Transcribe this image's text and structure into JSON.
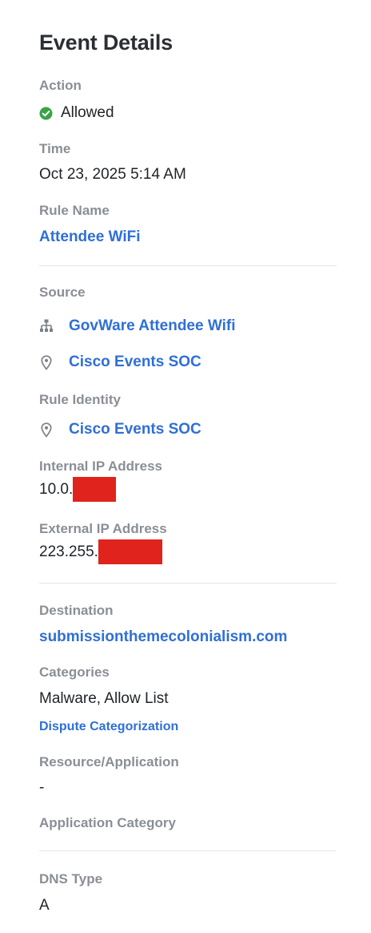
{
  "panel": {
    "title": "Event Details",
    "action": {
      "label": "Action",
      "value": "Allowed",
      "status_color": "#3aa346"
    },
    "time": {
      "label": "Time",
      "value": "Oct 23, 2025 5:14 AM"
    },
    "rule_name": {
      "label": "Rule Name",
      "value": "Attendee WiFi"
    },
    "source": {
      "label": "Source",
      "items": [
        {
          "icon": "network-icon",
          "value": "GovWare Attendee Wifi"
        },
        {
          "icon": "location-pin-icon",
          "value": "Cisco Events SOC"
        }
      ]
    },
    "rule_identity": {
      "label": "Rule Identity",
      "icon": "location-pin-icon",
      "value": "Cisco Events SOC"
    },
    "internal_ip": {
      "label": "Internal IP Address",
      "value_visible": "10.0.",
      "redacted": true
    },
    "external_ip": {
      "label": "External IP Address",
      "value_visible": "223.255.",
      "redacted": true
    },
    "destination": {
      "label": "Destination",
      "value": "submissionthemecolonialism.com"
    },
    "categories": {
      "label": "Categories",
      "value": "Malware, Allow List",
      "action_link": "Dispute Categorization"
    },
    "resource_application": {
      "label": "Resource/Application",
      "value": "-"
    },
    "application_category": {
      "label": "Application Category"
    },
    "dns_type": {
      "label": "DNS Type",
      "value": "A"
    }
  },
  "colors": {
    "link": "#2f6fd6",
    "label": "#8a8f96",
    "redaction": "#e0231c"
  }
}
